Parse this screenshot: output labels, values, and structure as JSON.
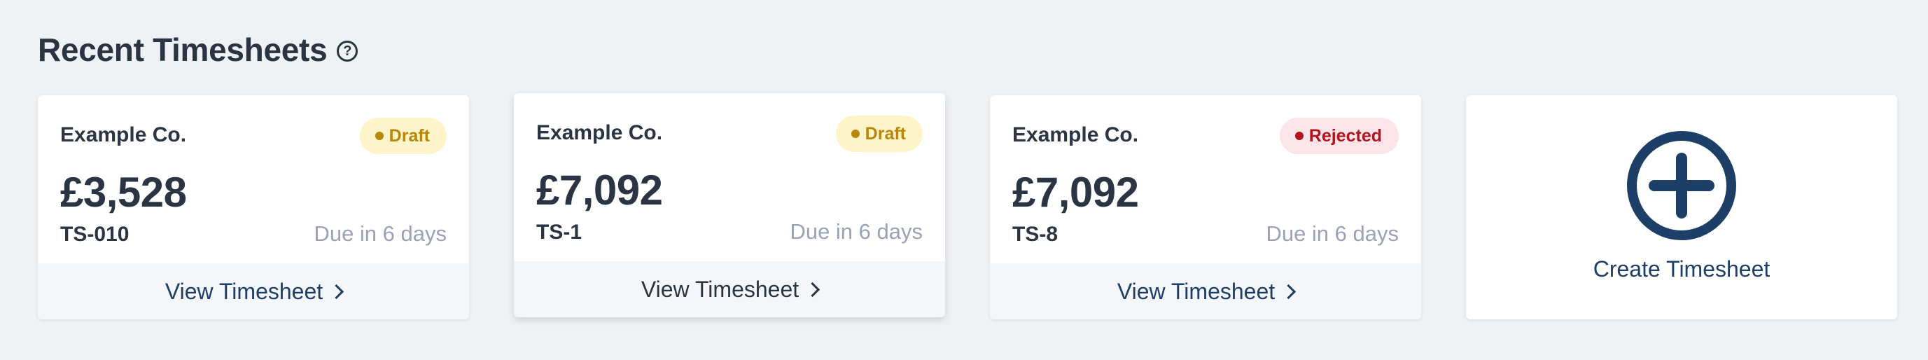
{
  "header": {
    "title": "Recent Timesheets",
    "help_glyph": "?"
  },
  "timesheets": [
    {
      "company": "Example Co.",
      "status": "Draft",
      "amount": "£3,528",
      "id": "TS-010",
      "due": "Due in 6 days",
      "action": "View Timesheet"
    },
    {
      "company": "Example Co.",
      "status": "Draft",
      "amount": "£7,092",
      "id": "TS-1",
      "due": "Due in 6 days",
      "action": "View Timesheet"
    },
    {
      "company": "Example Co.",
      "status": "Rejected",
      "amount": "£7,092",
      "id": "TS-8",
      "due": "Due in 6 days",
      "action": "View Timesheet"
    }
  ],
  "create": {
    "label": "Create Timesheet",
    "icon": "plus-circle-icon"
  },
  "colors": {
    "background": "#eff2f5",
    "primary": "#1d3e66",
    "draft_text": "#b8860b",
    "draft_bg": "#fdf4c9",
    "rejected_text": "#b3131f",
    "rejected_bg": "#fbe5e9"
  }
}
